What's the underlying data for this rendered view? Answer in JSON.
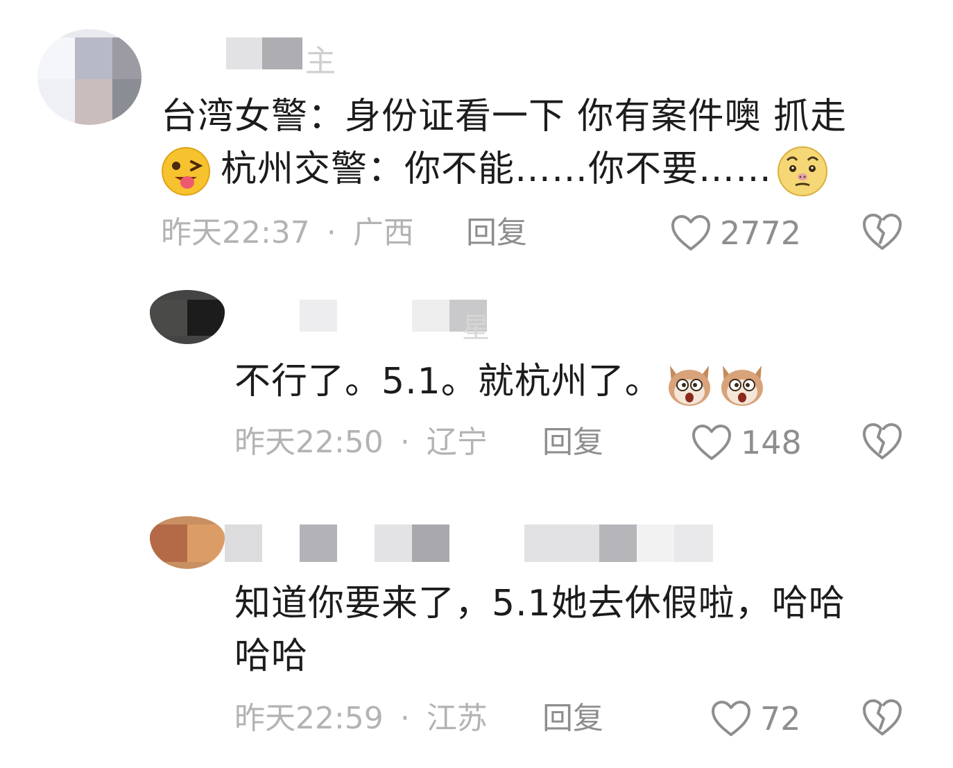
{
  "comments": [
    {
      "text_line1": "台湾女警：身份证看一下 你有案件噢 抓走",
      "text_line2": "杭州交警：你不能……你不要……",
      "time": "昨天22:37",
      "location": "广西",
      "reply_label": "回复",
      "likes": "2772",
      "emoji_left": "tongue-wink-emoji",
      "emoji_right": "disgust-emoji"
    },
    {
      "text_line1": "不行了。5.1。就杭州了。",
      "time": "昨天22:50",
      "location": "辽宁",
      "reply_label": "回复",
      "likes": "148",
      "emoji_right": "shocked-dog-emoji"
    },
    {
      "text_line1": "知道你要来了，5.1她去休假啦，哈哈",
      "text_line2": "哈哈",
      "time": "昨天22:59",
      "location": "江苏",
      "reply_label": "回复",
      "likes": "72"
    }
  ],
  "separator": "·",
  "username_visible_fragments": [
    "主",
    "星"
  ],
  "colors": {
    "meta_gray": "#b3b3b3",
    "action_gray": "#8e8e8e",
    "text": "#1c1c1c"
  }
}
